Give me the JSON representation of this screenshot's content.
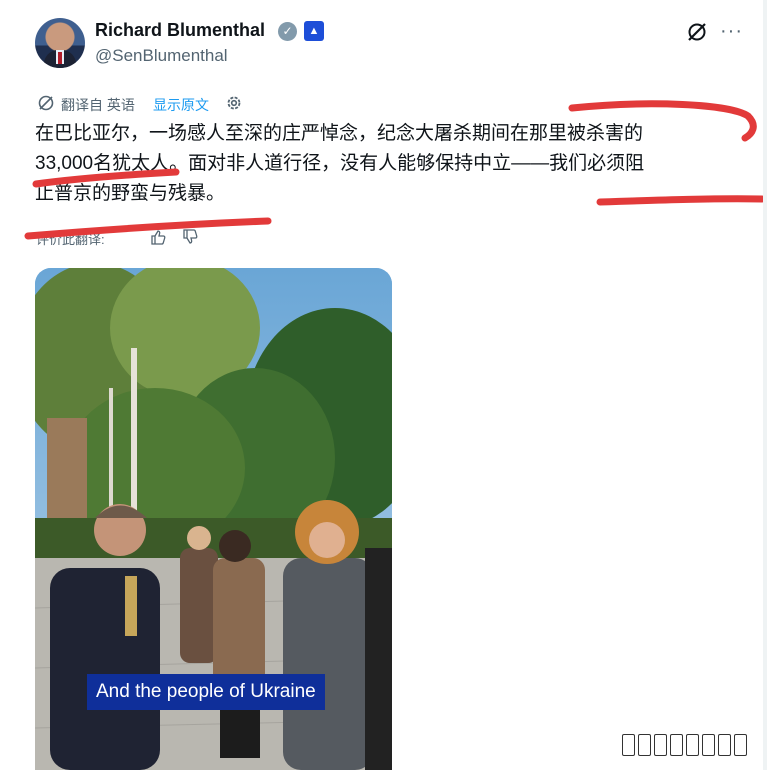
{
  "user": {
    "display_name": "Richard Blumenthal",
    "handle": "@SenBlumenthal",
    "verified_icon": "verified-badge-icon",
    "affiliation_icon": "capitol-badge-icon"
  },
  "header_actions": {
    "grok_icon": "grok-icon",
    "more_icon": "more-icon",
    "more_glyph": "···"
  },
  "translation": {
    "label": "翻译自 英语",
    "show_original": "显示原文",
    "settings_icon": "gear-icon",
    "rate_label": "评价此翻译:"
  },
  "tweet": {
    "text": "在巴比亚尔，一场感人至深的庄严悼念，纪念大屠杀期间在那里被杀害的\n33,000名犹太人。面对非人道行径，没有人能够保持中立——我们必须阻\n止普京的野蛮与残暴。"
  },
  "media": {
    "caption": "And the people of Ukraine"
  },
  "colors": {
    "text": "#0f1419",
    "secondary": "#536471",
    "link": "#1d9bf0",
    "marker": "#e23a3a",
    "caption_bg": "#0f2f9a"
  }
}
